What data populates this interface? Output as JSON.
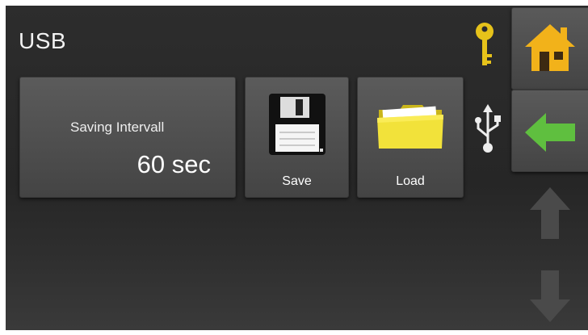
{
  "screen": {
    "title": "USB"
  },
  "interval": {
    "label": "Saving Intervall",
    "value": "60 sec"
  },
  "buttons": {
    "save_label": "Save",
    "load_label": "Load"
  },
  "icons": {
    "key": "key-icon",
    "usb": "usb-icon",
    "home": "home-icon",
    "back": "back-arrow-icon",
    "up": "up-arrow-icon",
    "down": "down-arrow-icon",
    "floppy": "floppy-disk-icon",
    "folder": "folder-icon"
  },
  "colors": {
    "home_accent": "#f2b21a",
    "back_accent": "#5fbf3f",
    "key_accent": "#e6c21a"
  }
}
